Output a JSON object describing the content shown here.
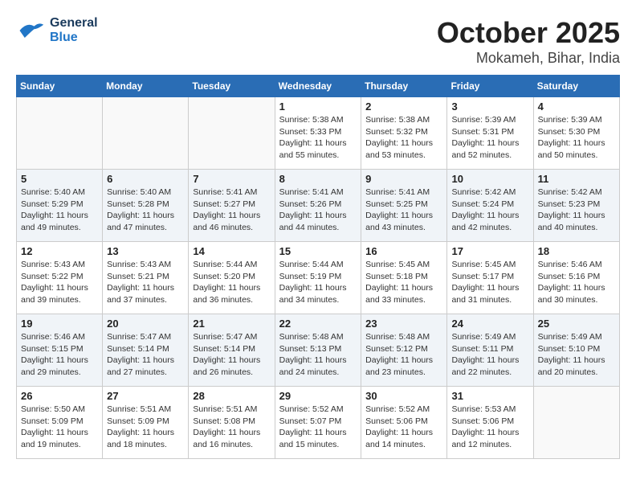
{
  "header": {
    "logo_line1": "General",
    "logo_line2": "Blue",
    "title": "October 2025",
    "subtitle": "Mokameh, Bihar, India"
  },
  "weekdays": [
    "Sunday",
    "Monday",
    "Tuesday",
    "Wednesday",
    "Thursday",
    "Friday",
    "Saturday"
  ],
  "weeks": [
    [
      {
        "day": "",
        "info": ""
      },
      {
        "day": "",
        "info": ""
      },
      {
        "day": "",
        "info": ""
      },
      {
        "day": "1",
        "info": "Sunrise: 5:38 AM\nSunset: 5:33 PM\nDaylight: 11 hours\nand 55 minutes."
      },
      {
        "day": "2",
        "info": "Sunrise: 5:38 AM\nSunset: 5:32 PM\nDaylight: 11 hours\nand 53 minutes."
      },
      {
        "day": "3",
        "info": "Sunrise: 5:39 AM\nSunset: 5:31 PM\nDaylight: 11 hours\nand 52 minutes."
      },
      {
        "day": "4",
        "info": "Sunrise: 5:39 AM\nSunset: 5:30 PM\nDaylight: 11 hours\nand 50 minutes."
      }
    ],
    [
      {
        "day": "5",
        "info": "Sunrise: 5:40 AM\nSunset: 5:29 PM\nDaylight: 11 hours\nand 49 minutes."
      },
      {
        "day": "6",
        "info": "Sunrise: 5:40 AM\nSunset: 5:28 PM\nDaylight: 11 hours\nand 47 minutes."
      },
      {
        "day": "7",
        "info": "Sunrise: 5:41 AM\nSunset: 5:27 PM\nDaylight: 11 hours\nand 46 minutes."
      },
      {
        "day": "8",
        "info": "Sunrise: 5:41 AM\nSunset: 5:26 PM\nDaylight: 11 hours\nand 44 minutes."
      },
      {
        "day": "9",
        "info": "Sunrise: 5:41 AM\nSunset: 5:25 PM\nDaylight: 11 hours\nand 43 minutes."
      },
      {
        "day": "10",
        "info": "Sunrise: 5:42 AM\nSunset: 5:24 PM\nDaylight: 11 hours\nand 42 minutes."
      },
      {
        "day": "11",
        "info": "Sunrise: 5:42 AM\nSunset: 5:23 PM\nDaylight: 11 hours\nand 40 minutes."
      }
    ],
    [
      {
        "day": "12",
        "info": "Sunrise: 5:43 AM\nSunset: 5:22 PM\nDaylight: 11 hours\nand 39 minutes."
      },
      {
        "day": "13",
        "info": "Sunrise: 5:43 AM\nSunset: 5:21 PM\nDaylight: 11 hours\nand 37 minutes."
      },
      {
        "day": "14",
        "info": "Sunrise: 5:44 AM\nSunset: 5:20 PM\nDaylight: 11 hours\nand 36 minutes."
      },
      {
        "day": "15",
        "info": "Sunrise: 5:44 AM\nSunset: 5:19 PM\nDaylight: 11 hours\nand 34 minutes."
      },
      {
        "day": "16",
        "info": "Sunrise: 5:45 AM\nSunset: 5:18 PM\nDaylight: 11 hours\nand 33 minutes."
      },
      {
        "day": "17",
        "info": "Sunrise: 5:45 AM\nSunset: 5:17 PM\nDaylight: 11 hours\nand 31 minutes."
      },
      {
        "day": "18",
        "info": "Sunrise: 5:46 AM\nSunset: 5:16 PM\nDaylight: 11 hours\nand 30 minutes."
      }
    ],
    [
      {
        "day": "19",
        "info": "Sunrise: 5:46 AM\nSunset: 5:15 PM\nDaylight: 11 hours\nand 29 minutes."
      },
      {
        "day": "20",
        "info": "Sunrise: 5:47 AM\nSunset: 5:14 PM\nDaylight: 11 hours\nand 27 minutes."
      },
      {
        "day": "21",
        "info": "Sunrise: 5:47 AM\nSunset: 5:14 PM\nDaylight: 11 hours\nand 26 minutes."
      },
      {
        "day": "22",
        "info": "Sunrise: 5:48 AM\nSunset: 5:13 PM\nDaylight: 11 hours\nand 24 minutes."
      },
      {
        "day": "23",
        "info": "Sunrise: 5:48 AM\nSunset: 5:12 PM\nDaylight: 11 hours\nand 23 minutes."
      },
      {
        "day": "24",
        "info": "Sunrise: 5:49 AM\nSunset: 5:11 PM\nDaylight: 11 hours\nand 22 minutes."
      },
      {
        "day": "25",
        "info": "Sunrise: 5:49 AM\nSunset: 5:10 PM\nDaylight: 11 hours\nand 20 minutes."
      }
    ],
    [
      {
        "day": "26",
        "info": "Sunrise: 5:50 AM\nSunset: 5:09 PM\nDaylight: 11 hours\nand 19 minutes."
      },
      {
        "day": "27",
        "info": "Sunrise: 5:51 AM\nSunset: 5:09 PM\nDaylight: 11 hours\nand 18 minutes."
      },
      {
        "day": "28",
        "info": "Sunrise: 5:51 AM\nSunset: 5:08 PM\nDaylight: 11 hours\nand 16 minutes."
      },
      {
        "day": "29",
        "info": "Sunrise: 5:52 AM\nSunset: 5:07 PM\nDaylight: 11 hours\nand 15 minutes."
      },
      {
        "day": "30",
        "info": "Sunrise: 5:52 AM\nSunset: 5:06 PM\nDaylight: 11 hours\nand 14 minutes."
      },
      {
        "day": "31",
        "info": "Sunrise: 5:53 AM\nSunset: 5:06 PM\nDaylight: 11 hours\nand 12 minutes."
      },
      {
        "day": "",
        "info": ""
      }
    ]
  ]
}
